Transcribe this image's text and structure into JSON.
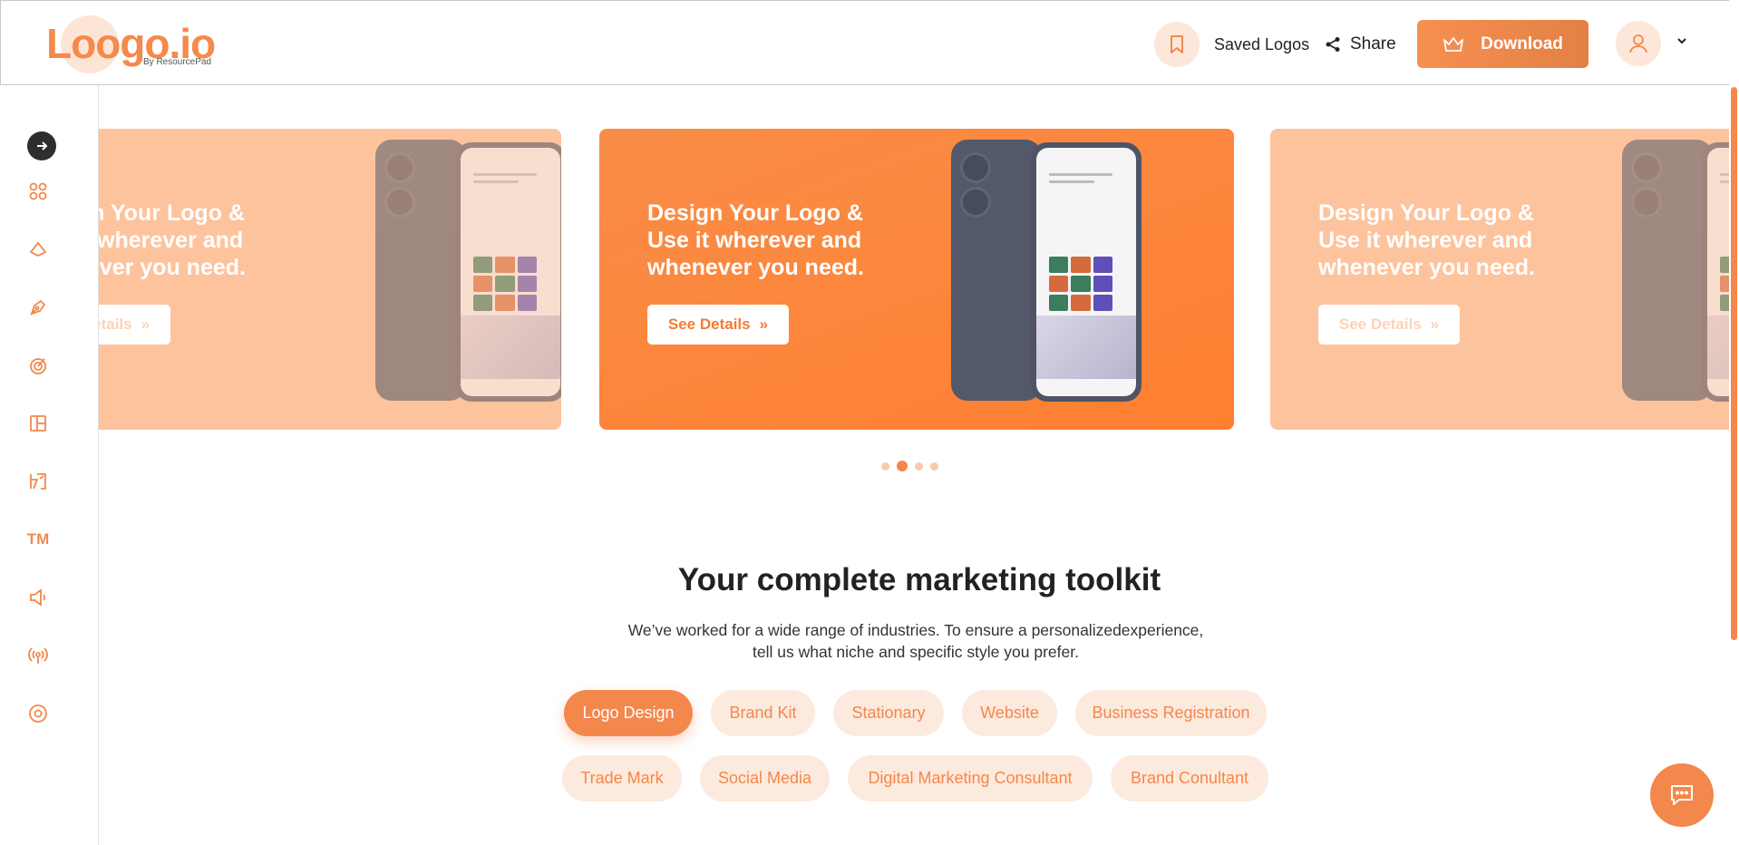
{
  "header": {
    "logo_text": "Loogo.io",
    "logo_sub": "By ResourcePad",
    "saved_label": "Saved Logos",
    "share_label": "Share",
    "download_label": "Download"
  },
  "sidebar": {
    "items": [
      "grid-icon",
      "shapes-icon",
      "pen-nib-icon",
      "target-icon",
      "layout-icon",
      "brand-icon",
      "trademark-icon",
      "megaphone-icon",
      "broadcast-icon",
      "circle-target-icon"
    ],
    "tm_label": "TM"
  },
  "carousel": {
    "slides": [
      {
        "title": "Design Your Logo & Use it wherever and whenever you need.",
        "button": "See Details"
      },
      {
        "title": "Design Your Logo & Use it wherever and whenever you need.",
        "button": "See Details"
      },
      {
        "title": "Design Your Logo & Use it wherever and whenever you need.",
        "button": "See Details"
      }
    ],
    "dot_count": 4,
    "active_dot": 2
  },
  "toolkit": {
    "title": "Your complete marketing toolkit",
    "description": "We’ve worked for a wide range of industries. To ensure a personalizedexperience, tell us what niche and specific style you prefer.",
    "chips_row1": [
      "Logo Design",
      "Brand Kit",
      "Stationary",
      "Website",
      "Business Registration"
    ],
    "chips_row2": [
      "Trade Mark",
      "Social Media",
      "Digital Marketing Consultant",
      "Brand Conultant"
    ],
    "active_chip": "Logo Design"
  },
  "colors": {
    "accent": "#f4874b",
    "accent_light": "#fdeade",
    "slide_side": "#fdc39d"
  }
}
